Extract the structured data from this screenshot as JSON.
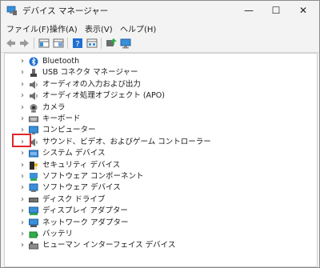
{
  "window": {
    "title": "デバイス マネージャー"
  },
  "controls": {
    "minimize": "—",
    "maximize": "☐",
    "close": "✕"
  },
  "menu": [
    {
      "label": "ファイル(F)"
    },
    {
      "label": "操作(A)"
    },
    {
      "label": "表示(V)"
    },
    {
      "label": "ヘルプ(H)"
    }
  ],
  "tree": {
    "items": [
      {
        "label": "Bluetooth",
        "icon": "bluetooth-icon"
      },
      {
        "label": "USB コネクタ マネージャー",
        "icon": "usb-connector-icon"
      },
      {
        "label": "オーディオの入力および出力",
        "icon": "speaker-icon"
      },
      {
        "label": "オーディオ処理オブジェクト (APO)",
        "icon": "speaker-icon"
      },
      {
        "label": "カメラ",
        "icon": "camera-icon"
      },
      {
        "label": "キーボード",
        "icon": "keyboard-icon"
      },
      {
        "label": "コンピューター",
        "icon": "computer-icon"
      },
      {
        "label": "サウンド、ビデオ、およびゲーム コントローラー",
        "icon": "speaker-icon"
      },
      {
        "label": "システム デバイス",
        "icon": "system-devices-icon"
      },
      {
        "label": "セキュリティ デバイス",
        "icon": "security-icon"
      },
      {
        "label": "ソフトウェア コンポーネント",
        "icon": "software-component-icon"
      },
      {
        "label": "ソフトウェア デバイス",
        "icon": "software-device-icon"
      },
      {
        "label": "ディスク ドライブ",
        "icon": "disk-drive-icon"
      },
      {
        "label": "ディスプレイ アダプター",
        "icon": "display-adapter-icon"
      },
      {
        "label": "ネットワーク アダプター",
        "icon": "network-adapter-icon"
      },
      {
        "label": "バッテリ",
        "icon": "battery-icon"
      },
      {
        "label": "ヒューマン インターフェイス デバイス",
        "icon": "hid-icon"
      }
    ]
  },
  "colors": {
    "highlight": "#e0262b",
    "accent": "#1f6fd1"
  }
}
